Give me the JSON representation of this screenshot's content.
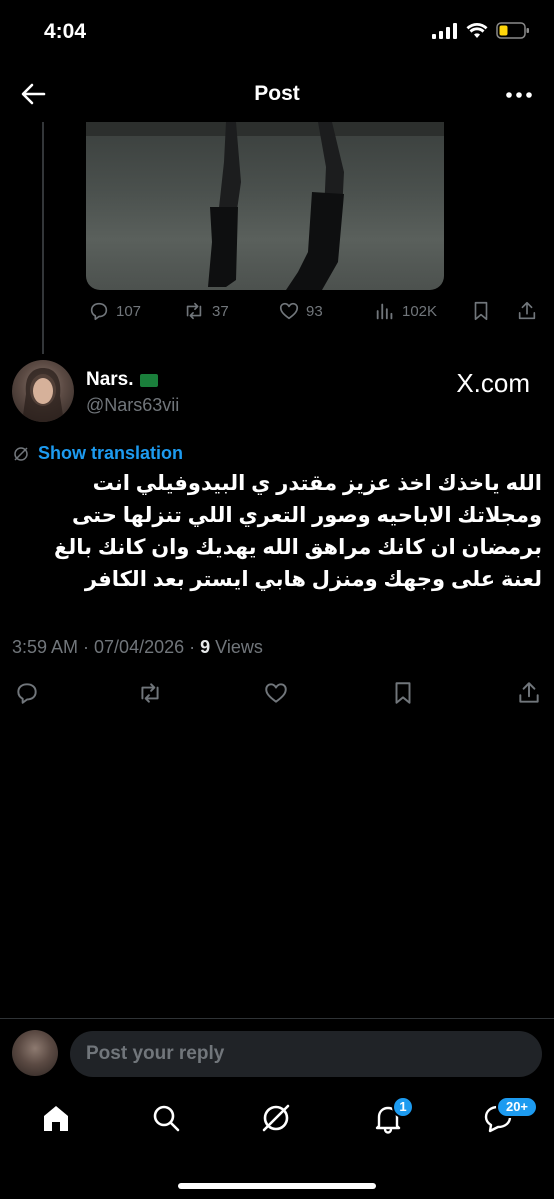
{
  "status_bar": {
    "time": "4:04"
  },
  "header": {
    "title": "Post"
  },
  "parent_post": {
    "replies": "107",
    "reposts": "37",
    "likes": "93",
    "views": "102K"
  },
  "author": {
    "name": "Nars.",
    "handle": "@Nars63vii",
    "watermark": "X.com"
  },
  "translate_label": "Show translation",
  "tweet_lines": [
    "الله ياخذك اخذ عزيز مقتدر ي البيدوفيلي انت",
    "ومجلاتك الاباحيه وصور التعري اللي تنزلها حتى",
    "برمضان ان كانك مراهق الله يهديك وان كانك بالغ",
    "لعنة على وجهك ومنزل هابي ايستر بعد الكافر"
  ],
  "meta": {
    "time_date": "3:59 AM · 07/04/2026 · ",
    "views_count": "9",
    "views_label": " Views"
  },
  "reply": {
    "placeholder": "Post your reply"
  },
  "nav": {
    "notifications_badge": "1",
    "messages_badge": "20+"
  },
  "colors": {
    "accent": "#1d9bf0",
    "muted": "#71767b",
    "background": "#000000"
  }
}
